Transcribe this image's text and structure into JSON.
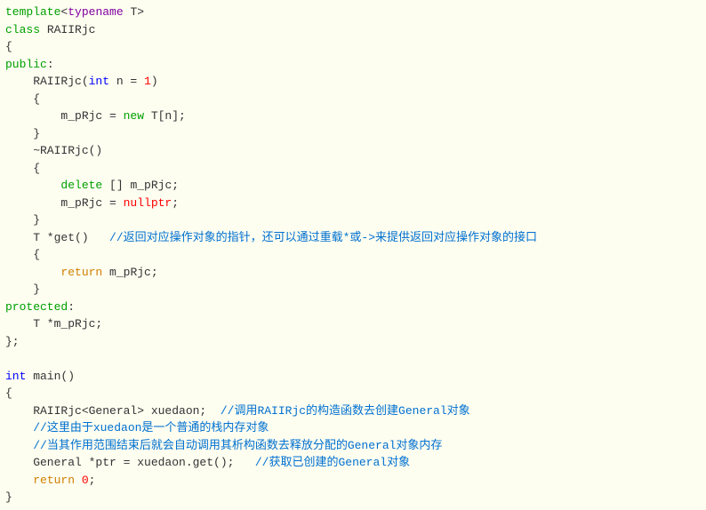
{
  "code": {
    "l1_template": "template",
    "l1_typename": "typename",
    "l1_T": " T>",
    "l2_class": "class",
    "l2_name": " RAIIRjc",
    "l3": "{",
    "l4_public": "public",
    "l4_colon": ":",
    "l5_ctor": "    RAIIRjc(",
    "l5_int": "int",
    "l5_n": " n = ",
    "l5_one": "1",
    "l5_close": ")",
    "l6": "    {",
    "l7_a": "        m_pRjc = ",
    "l7_new": "new",
    "l7_b": " T[n];",
    "l8": "    }",
    "l9": "    ~RAIIRjc()",
    "l10": "    {",
    "l11_indent": "        ",
    "l11_delete": "delete",
    "l11_rest": " [] m_pRjc;",
    "l12_a": "        m_pRjc = ",
    "l12_null": "nullptr",
    "l12_semi": ";",
    "l13": "    }",
    "l14_a": "    T *get()   ",
    "l14_comment": "//返回对应操作对象的指针，还可以通过重载*或->来提供返回对应操作对象的接口",
    "l15": "    {",
    "l16_indent": "        ",
    "l16_return": "return",
    "l16_rest": " m_pRjc;",
    "l17": "    }",
    "l18_protected": "protected",
    "l18_colon": ":",
    "l19": "    T *m_pRjc;",
    "l20": "};",
    "l21": "",
    "l22_int": "int",
    "l22_main": " main()",
    "l23": "{",
    "l24_a": "    RAIIRjc<General> xuedaon;  ",
    "l24_comment": "//调用RAIIRjc的构造函数去创建General对象",
    "l25_indent": "    ",
    "l25_comment": "//这里由于xuedaon是一个普通的栈内存对象",
    "l26_indent": "    ",
    "l26_comment": "//当其作用范围结束后就会自动调用其析构函数去释放分配的General对象内存",
    "l27_a": "    General *ptr = xuedaon.get();   ",
    "l27_comment": "//获取已创建的General对象",
    "l28_indent": "    ",
    "l28_return": "return",
    "l28_sp": " ",
    "l28_zero": "0",
    "l28_semi": ";",
    "l29": "}"
  }
}
